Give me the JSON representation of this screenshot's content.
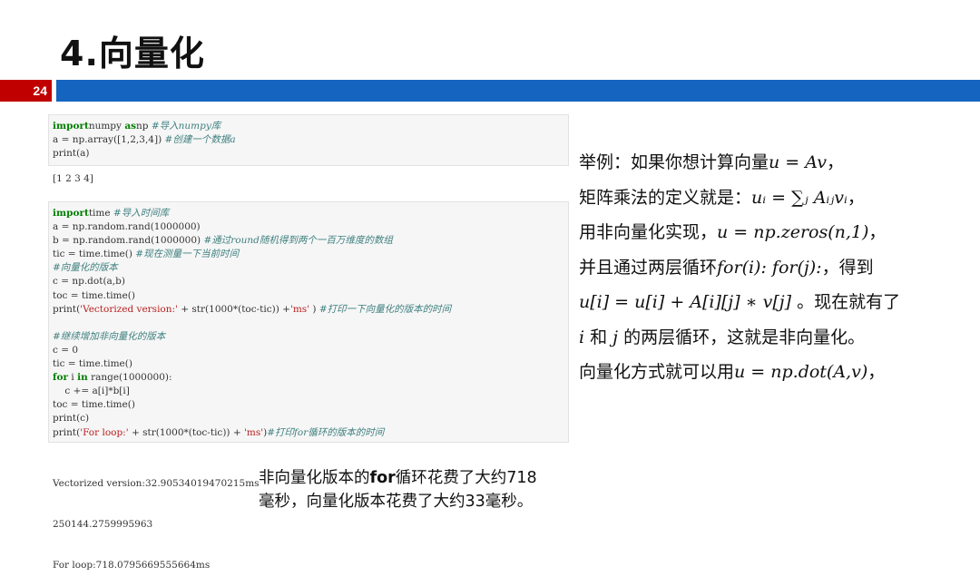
{
  "header": {
    "title": "4.向量化",
    "page_number": "24"
  },
  "code1": {
    "lines": [
      [
        [
          "kw",
          "import"
        ],
        [
          "",
          "numpy "
        ],
        [
          "kw",
          "as"
        ],
        [
          "",
          "np "
        ],
        [
          "cm",
          "#导入numpy库"
        ]
      ],
      [
        [
          "",
          "a = np.array([1,2,3,4]) "
        ],
        [
          "cm",
          "#创建一个数据a"
        ]
      ],
      [
        [
          "",
          "print(a)"
        ]
      ]
    ]
  },
  "output1": "[1 2 3 4]",
  "code2": {
    "lines": [
      [
        [
          "kw",
          "import"
        ],
        [
          "",
          "time "
        ],
        [
          "cm",
          "#导入时间库"
        ]
      ],
      [
        [
          "",
          "a = np.random.rand(1000000)"
        ]
      ],
      [
        [
          "",
          "b = np.random.rand(1000000) "
        ],
        [
          "cm",
          "#通过round随机得到两个一百万维度的数组"
        ]
      ],
      [
        [
          "",
          "tic = time.time() "
        ],
        [
          "cm",
          "#现在测量一下当前时间"
        ]
      ],
      [
        [
          "cm",
          "#向量化的版本"
        ]
      ],
      [
        [
          "",
          "c = np.dot(a,b)"
        ]
      ],
      [
        [
          "",
          "toc = time.time()"
        ]
      ],
      [
        [
          "",
          "print("
        ],
        [
          "str",
          "'Vectorized version:'"
        ],
        [
          "",
          " + str(1000*(toc-tic)) +"
        ],
        [
          "str",
          "'ms'"
        ],
        [
          "",
          " ) "
        ],
        [
          "cm",
          "#打印一下向量化的版本的时间"
        ]
      ],
      [
        [
          "",
          ""
        ]
      ],
      [
        [
          "cm",
          "#继续增加非向量化的版本"
        ]
      ],
      [
        [
          "",
          "c = 0"
        ]
      ],
      [
        [
          "",
          "tic = time.time()"
        ]
      ],
      [
        [
          "kw",
          "for"
        ],
        [
          "",
          " i "
        ],
        [
          "kw",
          "in"
        ],
        [
          "",
          " range(1000000):"
        ]
      ],
      [
        [
          "",
          "    c += a[i]*b[i]"
        ]
      ],
      [
        [
          "",
          "toc = time.time()"
        ]
      ],
      [
        [
          "",
          "print(c)"
        ]
      ],
      [
        [
          "",
          "print("
        ],
        [
          "str",
          "'For loop:'"
        ],
        [
          "",
          " + str(1000*(toc-tic)) + "
        ],
        [
          "str",
          "'ms'"
        ],
        [
          "",
          ")"
        ],
        [
          "cm",
          "#打印for循环的版本的时间"
        ]
      ]
    ]
  },
  "output2": {
    "lines": [
      "Vectorized version:32.90534019470215ms",
      "250144.2759995963",
      "For loop:718.0795669555664ms"
    ]
  },
  "note": {
    "line1_pre": "非向量化版本的",
    "line1_bold": "for",
    "line1_post": "循环花费了大约718",
    "line2": "毫秒，向量化版本花费了大约33毫秒。"
  },
  "explain": {
    "l1_text": "举例：如果你想计算向量",
    "l1_math": "u = Av",
    "l1_end": "，",
    "l2_text": "矩阵乘法的定义就是：",
    "l2_math": "uᵢ = ∑ⱼ Aᵢⱼvᵢ",
    "l2_end": "，",
    "l3_text": "用非向量化实现，",
    "l3_math": "u = np.zeros(n,1)",
    "l3_end": "，",
    "l4_text": "并且通过两层循环",
    "l4_math": "for(i): for(j):",
    "l4_end": "，得到",
    "l5_math": "u[i] = u[i] + A[i][j] ∗ v[j]",
    "l5_end": " 。现在就有了",
    "l6_math_i": "i",
    "l6_mid": " 和 ",
    "l6_math_j": "j",
    "l6_end": " 的两层循环，这就是非向量化。",
    "l7_text": "向量化方式就可以用",
    "l7_math": "u = np.dot(A,v)",
    "l7_end": "，"
  }
}
